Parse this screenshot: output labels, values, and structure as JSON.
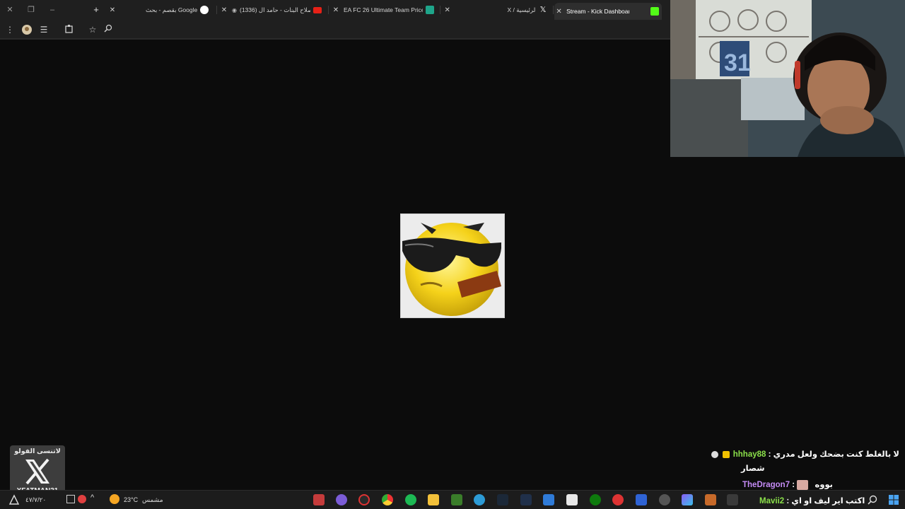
{
  "browser": {
    "tabs": [
      {
        "label": "بقصم - بحث Google"
      },
      {
        "label": "(1336) صلاح البنات - حامد ال..."
      },
      {
        "label": "EA FC 26 Ultimate Team Prices"
      },
      {
        "label": "X / الرئيسية"
      },
      {
        "label": "Stream - Kick Dashboard"
      }
    ]
  },
  "overlay": {
    "x_caption_top": "لاتنسى الفولو",
    "x_handle": "XFATMAN31"
  },
  "chat": {
    "messages": [
      {
        "user": "hhhay88",
        "text": "لا بالغلط كنت بضحك ولعل مدري",
        "text2": "شصار",
        "color": "#8be04a"
      },
      {
        "user": "TheDragon7",
        "text": "بووه",
        "color": "#c48bf5"
      },
      {
        "user": "Mavii2",
        "text": "اكتب اير ليف او اي",
        "color": "#8be04a"
      }
    ]
  },
  "taskbar": {
    "weather_temp": "23°C",
    "weather_desc": "مشمس",
    "date": "٤٧/٧/٢٠"
  },
  "colors": {
    "kick_green": "#53fc18",
    "youtube_red": "#e62117",
    "accent_blue": "#3b8dd6"
  }
}
